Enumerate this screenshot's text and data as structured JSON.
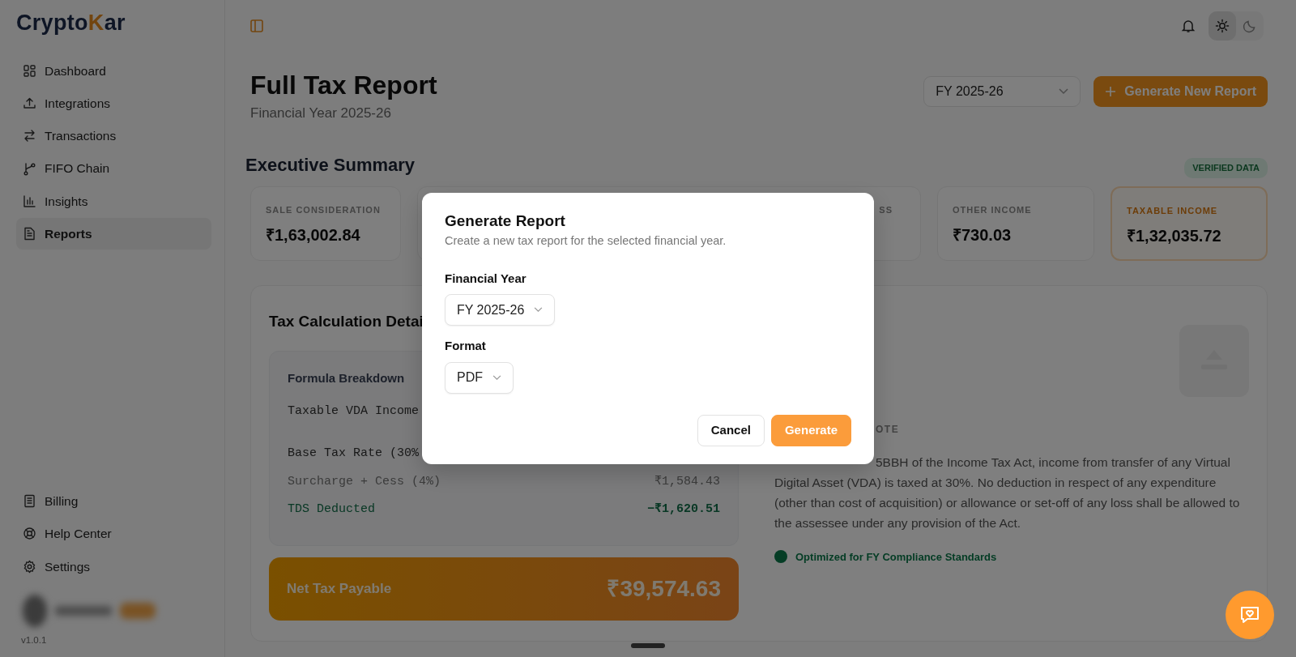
{
  "sidebar": {
    "logo": {
      "parts": [
        {
          "text": "Crypto",
          "accent": false
        },
        {
          "text": "K",
          "accent": true
        },
        {
          "text": "ar",
          "accent": false
        }
      ]
    },
    "nav": [
      {
        "label": "Dashboard",
        "kind": "grid",
        "selected": false
      },
      {
        "label": "Integrations",
        "kind": "upload",
        "selected": false
      },
      {
        "label": "Transactions",
        "kind": "swap",
        "selected": false
      },
      {
        "label": "FIFO Chain",
        "kind": "branch",
        "selected": false
      },
      {
        "label": "Insights",
        "kind": "chart",
        "selected": false
      },
      {
        "label": "Reports",
        "kind": "file",
        "selected": true
      }
    ],
    "footer_nav": [
      {
        "label": "Billing",
        "kind": "receipt",
        "selected": false
      },
      {
        "label": "Help Center",
        "kind": "lifebuoy",
        "selected": false
      },
      {
        "label": "Settings",
        "kind": "gear",
        "selected": false
      }
    ],
    "version": "v1.0.1"
  },
  "topbar": {
    "theme_toggle": [
      {
        "kind": "sun",
        "selected": true
      },
      {
        "kind": "moon",
        "selected": false
      }
    ]
  },
  "header": {
    "title": "Full Tax Report",
    "subtitle": "Financial Year 2025-26",
    "year_select": "FY 2025-26",
    "generate_button": "Generate New Report"
  },
  "summary": {
    "title": "Executive Summary",
    "badge": "VERIFIED DATA",
    "cards": [
      {
        "label": "SALE CONSIDERATION",
        "value": "₹1,63,002.84",
        "highlight": false
      },
      {
        "label": "SS",
        "highlight": false
      },
      {
        "label": "OTHER INCOME",
        "value": "₹730.03",
        "highlight": false
      },
      {
        "label": "TAXABLE INCOME",
        "value": "₹1,32,035.72",
        "highlight": true
      }
    ]
  },
  "tax_details": {
    "title": "Tax Calculation Detai",
    "formula": {
      "title": "Formula Breakdown",
      "rows": [
        {
          "label": "Taxable VDA Income",
          "kind": "primary"
        },
        {
          "label": "Base Tax Rate (30%",
          "kind": "primary"
        },
        {
          "label": "Surcharge + Cess (4%)",
          "value": "₹1,584.43",
          "kind": "muted"
        },
        {
          "label": "TDS Deducted",
          "value": "−₹1,620.51",
          "kind": "deduction"
        }
      ]
    },
    "net": {
      "label": "Net Tax Payable",
      "value": "₹39,574.63"
    }
  },
  "note": {
    "label": "OTE",
    "text": "5BBH of the Income Tax Act, income from transfer of any Virtual Digital Asset (VDA) is taxed at 30%. No deduction in respect of any expenditure (other than cost of acquisition) or allowance or set-off of any loss shall be allowed to the assessee under any provision of the Act.",
    "compliance": "Optimized for FY Compliance Standards"
  },
  "modal": {
    "title": "Generate Report",
    "subtitle": "Create a new tax report for the selected financial year.",
    "fields": [
      {
        "label": "Financial Year",
        "value": "FY 2025-26"
      },
      {
        "label": "Format",
        "value": "PDF"
      }
    ],
    "buttons": [
      {
        "label": "Cancel",
        "kind": "secondary"
      },
      {
        "label": "Generate",
        "kind": "primary"
      }
    ]
  }
}
